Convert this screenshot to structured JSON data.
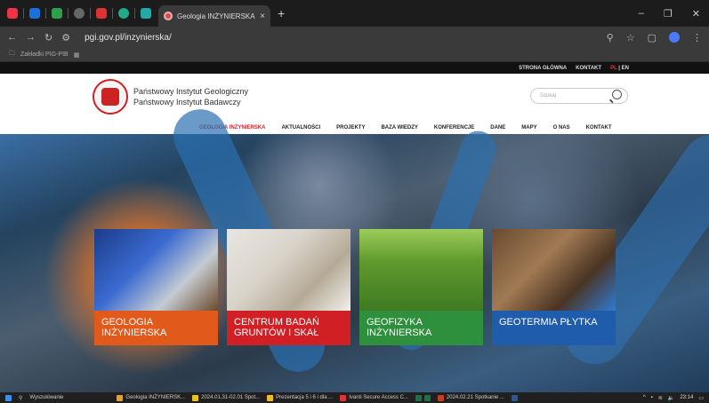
{
  "browser": {
    "active_tab": {
      "title": "Geologia INŻYNIERSKA - Państ"
    },
    "new_tab_icon": "plus-icon",
    "url": "pgi.gov.pl/inzynierska/",
    "bookmark": "Zakładki PIG-PIB"
  },
  "site": {
    "topbar": {
      "home": "STRONA GŁÓWNA",
      "contact": "KONTAKT",
      "lang_pl": "PL",
      "lang_sep": "|",
      "lang_en": "EN"
    },
    "institute": {
      "line1": "Państwowy Instytut Geologiczny",
      "line2": "Państwowy Instytut Badawczy"
    },
    "search": {
      "placeholder": "Szukaj"
    },
    "nav": [
      {
        "label": "GEOLOGIA INŻYNIERSKA",
        "active": true
      },
      {
        "label": "AKTUALNOŚCI"
      },
      {
        "label": "PROJEKTY"
      },
      {
        "label": "BAZA WIEDZY"
      },
      {
        "label": "KONFERENCJE"
      },
      {
        "label": "DANE"
      },
      {
        "label": "MAPY"
      },
      {
        "label": "O NAS"
      },
      {
        "label": "KONTAKT"
      }
    ],
    "cards": [
      {
        "label": "GEOLOGIA INŻYNIERSKA",
        "color": "#e15a1b"
      },
      {
        "label": "CENTRUM BADAŃ GRUNTÓW I SKAŁ",
        "color": "#d11f26"
      },
      {
        "label": "GEOFIZYKA INŻYNIERSKA",
        "color": "#2e8f3d"
      },
      {
        "label": "GEOTERMIA PŁYTKA",
        "color": "#1f5cab"
      }
    ]
  },
  "taskbar": {
    "search": "Wyszukiwanie",
    "items": [
      "Geologia INŻYNIERSK...",
      "2024.01.31-02.01 Spot...",
      "Prezentacja 5 i 6 i dla ...",
      "Ivanti Secure Access C...",
      "2024.02.21 Spotkanie ..."
    ],
    "time": "23:14"
  }
}
